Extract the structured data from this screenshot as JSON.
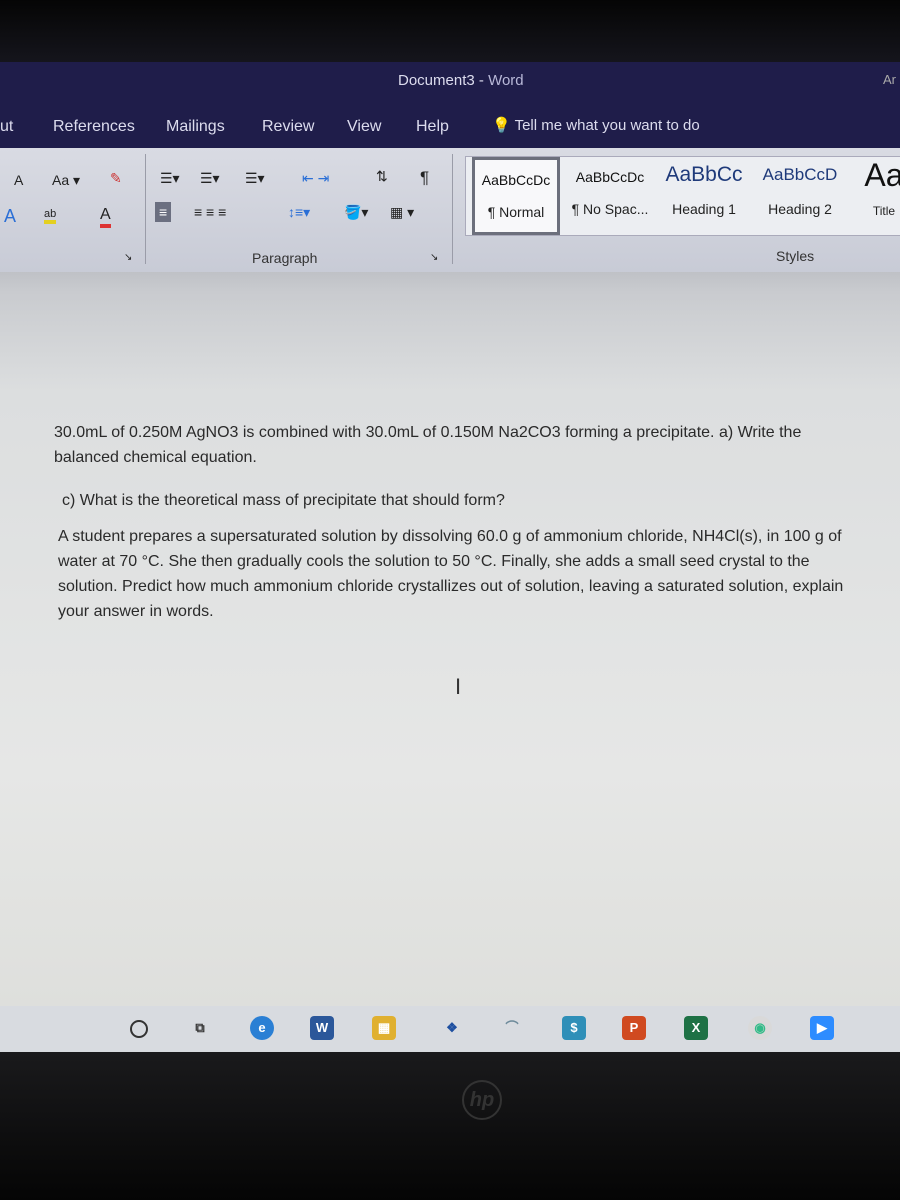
{
  "window": {
    "title": "Document3",
    "app": "Word",
    "account": "Ar"
  },
  "tabs": [
    "ut",
    "References",
    "Mailings",
    "Review",
    "View",
    "Help"
  ],
  "tell_me": "Tell me what you want to do",
  "ribbon": {
    "font_buttons": [
      "A",
      "Aa",
      "A",
      "ab",
      "A"
    ],
    "paragraph_label": "Paragraph",
    "styles_label": "Styles",
    "styles": [
      {
        "preview": "AaBbCcDc",
        "name": "¶ Normal"
      },
      {
        "preview": "AaBbCcDc",
        "name": "¶ No Spac..."
      },
      {
        "preview": "AaBbCc",
        "name": "Heading 1"
      },
      {
        "preview": "AaBbCcD",
        "name": "Heading 2"
      },
      {
        "preview": "Aa",
        "name": "Title"
      }
    ]
  },
  "document": {
    "paragraphs": [
      "30.0mL of 0.250M AgNO3 is combined with 30.0mL of 0.150M Na2CO3 forming a precipitate. a) Write the balanced chemical equation.",
      "c) What is the theoretical mass of precipitate that should form?",
      "A student prepares a supersaturated solution by dissolving 60.0 g of ammonium chloride, NH4Cl(s), in 100 g of water at 70 °C. She then gradually cools the solution to 50 °C. Finally, she adds a small seed crystal to the solution. Predict how much ammonium chloride crystallizes out of solution, leaving a saturated solution, explain your answer in words."
    ]
  },
  "taskbar": {
    "icons": [
      "search-icon",
      "task-view-icon",
      "edge-icon",
      "word-icon",
      "store-icon",
      "dropbox-icon",
      "photos-icon",
      "money-icon",
      "powerpoint-icon",
      "excel-icon",
      "chrome-icon",
      "zoom-icon"
    ]
  },
  "brand": "hp"
}
